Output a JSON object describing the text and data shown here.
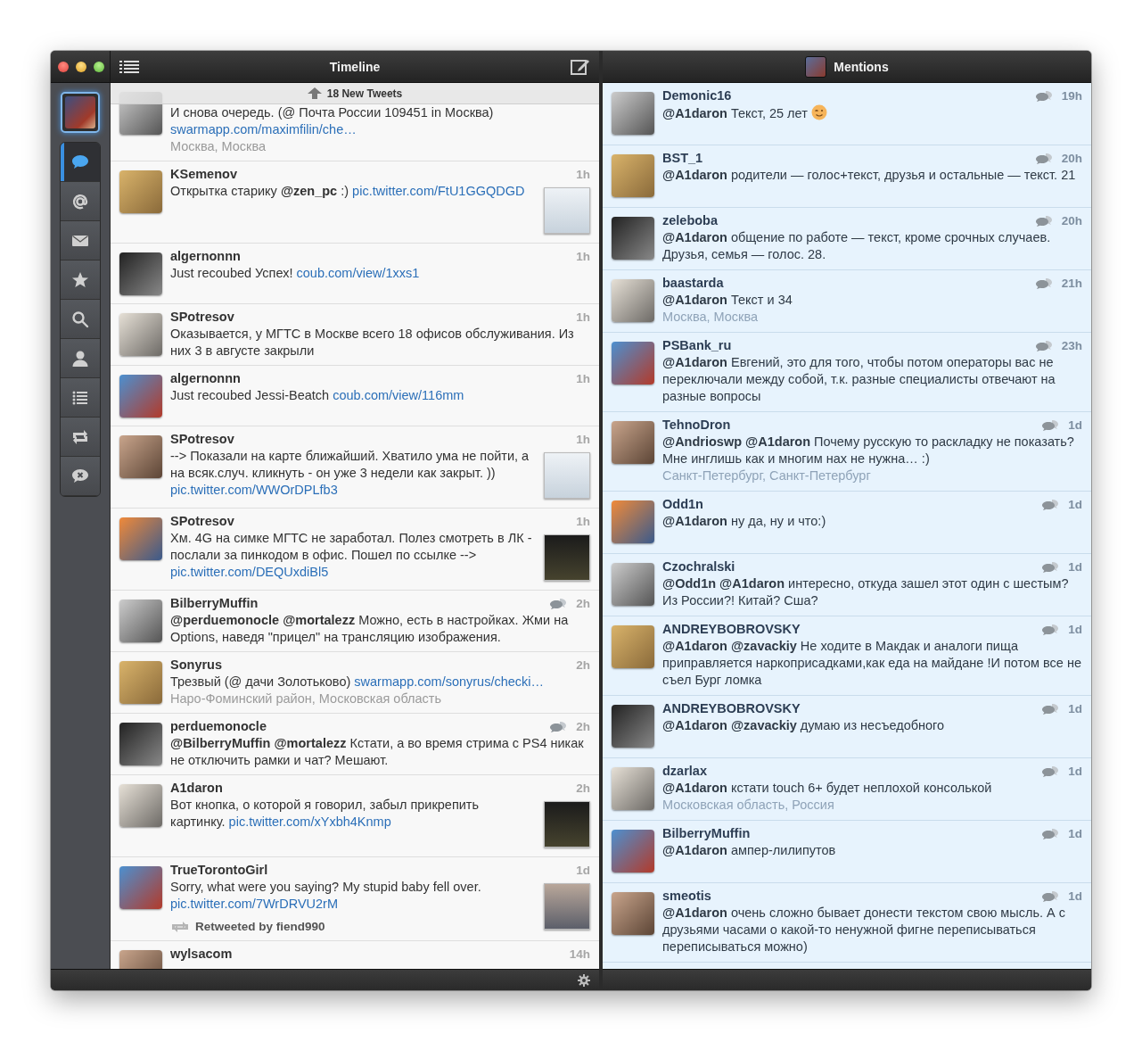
{
  "sidebar": {
    "items": [
      {
        "kind": "timeline",
        "selected": true
      },
      {
        "kind": "mentions",
        "selected": false
      },
      {
        "kind": "messages",
        "selected": false
      },
      {
        "kind": "favorites",
        "selected": false
      },
      {
        "kind": "search",
        "selected": false
      },
      {
        "kind": "profile",
        "selected": false
      },
      {
        "kind": "lists",
        "selected": false
      },
      {
        "kind": "retweets",
        "selected": false
      },
      {
        "kind": "muted",
        "selected": false
      }
    ]
  },
  "timeline": {
    "title": "Timeline",
    "banner": "18 New Tweets",
    "tweets": [
      {
        "conversation": false,
        "thumbnail": false,
        "parts": [
          {
            "kind": "text",
            "text": "И снова очередь. (@ Почта России 109451 in Москва) "
          },
          {
            "kind": "link",
            "text": "swarmapp.com/maximfilin/che…"
          }
        ],
        "location": "Москва, Москва"
      },
      {
        "user": "KSemenov",
        "time": "1h",
        "conversation": false,
        "thumbnail": true,
        "parts": [
          {
            "kind": "text",
            "text": "Открытка старику **@zen_pc** :) "
          },
          {
            "kind": "link",
            "text": "pic.twitter.com/FtU1GGQDGD"
          }
        ]
      },
      {
        "user": "algernonnn",
        "time": "1h",
        "conversation": false,
        "thumbnail": false,
        "parts": [
          {
            "kind": "text",
            "text": "Just recoubed Успех!  "
          },
          {
            "kind": "link",
            "text": "coub.com/view/1xxs1"
          }
        ]
      },
      {
        "user": "SPotresov",
        "time": "1h",
        "conversation": false,
        "thumbnail": false,
        "parts": [
          {
            "kind": "text",
            "text": "Оказывается, у МГТС в Москве всего 18 офисов обслуживания. Из них 3 в августе закрыли"
          }
        ]
      },
      {
        "user": "algernonnn",
        "time": "1h",
        "conversation": false,
        "thumbnail": false,
        "parts": [
          {
            "kind": "text",
            "text": "Just recoubed Jessi-Beatch "
          },
          {
            "kind": "link",
            "text": "coub.com/view/116mm"
          }
        ]
      },
      {
        "user": "SPotresov",
        "time": "1h",
        "conversation": false,
        "thumbnail": true,
        "parts": [
          {
            "kind": "text",
            "text": "--> Показали на карте ближайший. Хватило ума не пойти, а на всяк.случ. кликнуть - он уже 3 недели как закрыт. )) "
          },
          {
            "kind": "link",
            "text": "pic.twitter.com/WWOrDPLfb3"
          }
        ]
      },
      {
        "user": "SPotresov",
        "time": "1h",
        "conversation": false,
        "thumbnail": true,
        "parts": [
          {
            "kind": "text",
            "text": "Хм. 4G на симке МГТС не заработал. Полез смотреть в ЛК - послали за пинкодом в офис. Пошел по ссылке --> "
          },
          {
            "kind": "link",
            "text": "pic.twitter.com/DEQUxdiBl5"
          }
        ]
      },
      {
        "user": "BilberryMuffin",
        "time": "2h",
        "conversation": true,
        "thumbnail": false,
        "parts": [
          {
            "kind": "text",
            "text": "**@perduemonocle** **@mortalezz** Можно, есть в настройках. Жми на Options, наведя \"прицел\" на трансляцию изображения."
          }
        ]
      },
      {
        "user": "Sonyrus",
        "time": "2h",
        "conversation": false,
        "thumbnail": false,
        "parts": [
          {
            "kind": "text",
            "text": "Трезвый (@ дачи Золотьково) "
          },
          {
            "kind": "link",
            "text": "swarmapp.com/sonyrus/checki…"
          }
        ],
        "location": "Наро-Фоминский район, Московская область"
      },
      {
        "user": "perduemonocle",
        "time": "2h",
        "conversation": true,
        "thumbnail": false,
        "parts": [
          {
            "kind": "text",
            "text": "**@BilberryMuffin** **@mortalezz** Кстати, а во время стрима с PS4 никак не отключить рамки и чат? Мешают."
          }
        ]
      },
      {
        "user": "A1daron",
        "time": "2h",
        "conversation": false,
        "thumbnail": true,
        "parts": [
          {
            "kind": "text",
            "text": "Вот кнопка, о которой я говорил, забыл прикрепить картинку. "
          },
          {
            "kind": "link",
            "text": "pic.twitter.com/xYxbh4Knmp"
          }
        ]
      },
      {
        "user": "TrueTorontoGirl",
        "time": "1d",
        "conversation": false,
        "thumbnail": true,
        "parts": [
          {
            "kind": "text",
            "text": "Sorry, what were you saying? My stupid baby fell over. "
          },
          {
            "kind": "link",
            "text": "pic.twitter.com/7WrDRVU2rM"
          }
        ],
        "retweeted_by": "Retweeted by fiend990"
      },
      {
        "user": "wylsacom",
        "time": "14h",
        "conversation": false,
        "thumbnail": false
      }
    ]
  },
  "mentions": {
    "title": "Mentions",
    "tweets": [
      {
        "user": "Demonic16",
        "time": "19h",
        "conversation": true,
        "parts": [
          {
            "kind": "text",
            "text": "**@A1daron** Текст, 25 лет "
          },
          {
            "kind": "emoji"
          }
        ]
      },
      {
        "user": "BST_1",
        "time": "20h",
        "conversation": true,
        "parts": [
          {
            "kind": "text",
            "text": "**@A1daron** родители — голос+текст, друзья и остальные — текст. 21"
          }
        ]
      },
      {
        "user": "zeleboba",
        "time": "20h",
        "conversation": true,
        "parts": [
          {
            "kind": "text",
            "text": "**@A1daron** общение по работе — текст, кроме срочных случаев. Друзья, семья — голос. 28."
          }
        ]
      },
      {
        "user": "baastarda",
        "time": "21h",
        "conversation": true,
        "parts": [
          {
            "kind": "text",
            "text": "**@A1daron** Текст и 34"
          }
        ],
        "location": "Москва, Москва"
      },
      {
        "user": "PSBank_ru",
        "time": "23h",
        "conversation": true,
        "parts": [
          {
            "kind": "text",
            "text": "**@A1daron** Евгений, это для того, чтобы потом операторы вас не переключали между собой, т.к. разные специалисты отвечают на разные вопросы"
          }
        ]
      },
      {
        "user": "TehnoDron",
        "time": "1d",
        "conversation": true,
        "parts": [
          {
            "kind": "text",
            "text": "**@Andrioswp** **@A1daron** Почему русскую то раскладку не показать? Мне инглишь как и многим нах не нужна… :)"
          }
        ],
        "location": "Санкт-Петербург, Санкт-Петербург"
      },
      {
        "user": "Odd1n",
        "time": "1d",
        "conversation": true,
        "parts": [
          {
            "kind": "text",
            "text": "**@A1daron** ну да, ну и что:)"
          }
        ]
      },
      {
        "user": "Czochralski",
        "time": "1d",
        "conversation": true,
        "parts": [
          {
            "kind": "text",
            "text": "**@Odd1n** **@A1daron** интересно, откуда зашел этот один с шестым? Из России?! Китай?  Сша?"
          }
        ]
      },
      {
        "user": "ANDREYBOBROVSKY",
        "time": "1d",
        "conversation": true,
        "parts": [
          {
            "kind": "text",
            "text": "**@A1daron** **@zavackiy** Не ходите в Макдак и аналоги пища приправляется наркоприсадками,как еда на майдане !И потом все не съел Бург ломка"
          }
        ]
      },
      {
        "user": "ANDREYBOBROVSKY",
        "time": "1d",
        "conversation": true,
        "parts": [
          {
            "kind": "text",
            "text": "**@A1daron** **@zavackiy** думаю из несъедобного"
          }
        ]
      },
      {
        "user": "dzarlax",
        "time": "1d",
        "conversation": true,
        "parts": [
          {
            "kind": "text",
            "text": "**@A1daron** кстати touch 6+ будет неплохой консолькой"
          }
        ],
        "location": "Московская область, Россия"
      },
      {
        "user": "BilberryMuffin",
        "time": "1d",
        "conversation": true,
        "parts": [
          {
            "kind": "text",
            "text": "**@A1daron** ампер-лилипутов"
          }
        ]
      },
      {
        "user": "smeotis",
        "time": "1d",
        "conversation": true,
        "parts": [
          {
            "kind": "text",
            "text": "**@A1daron** очень сложно бывает донести текстом свою мысль. А с друзьями часами о какой-то ненужной фигне переписываться переписываться можно)"
          }
        ]
      }
    ]
  }
}
